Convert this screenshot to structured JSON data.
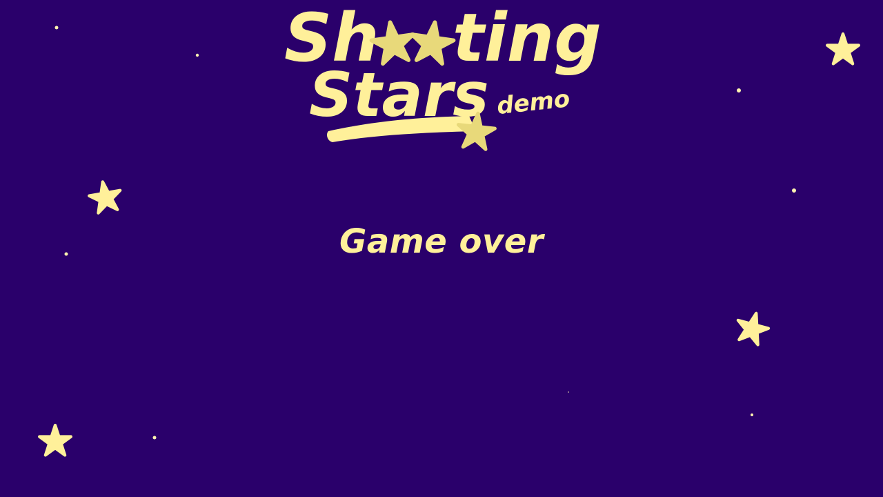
{
  "logo": {
    "line1_a": "Sh",
    "line1_b": "ting",
    "line2": "Stars",
    "tag": "demo"
  },
  "status": {
    "message": "Game over"
  },
  "colors": {
    "background": "#2a006b",
    "text": "#fff09a",
    "star": "#fff09a",
    "logo_star": "#e8d97a",
    "sparkle": "#fff3b0"
  },
  "icons": {
    "logo_stars": "star-icon",
    "background_stars": "star-icon",
    "sparkles": "sparkle-dot"
  }
}
